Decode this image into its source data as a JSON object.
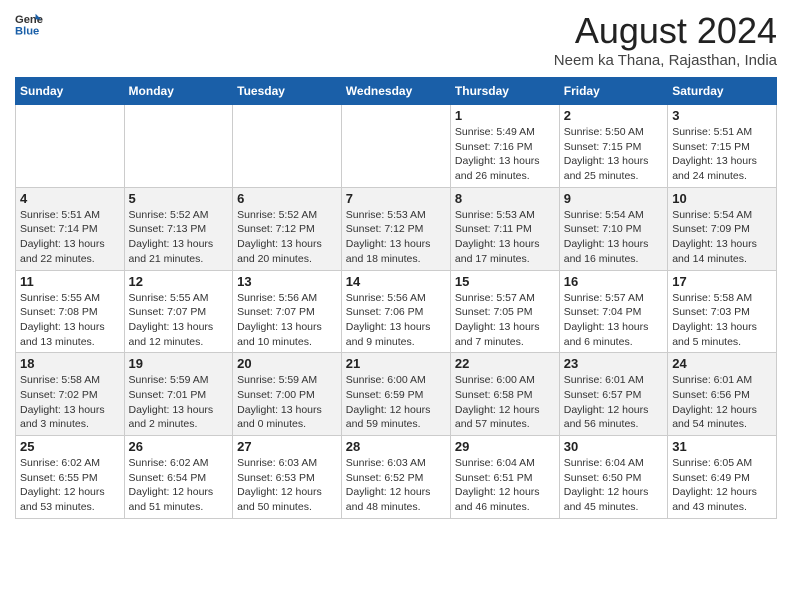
{
  "logo": {
    "line1": "General",
    "line2": "Blue"
  },
  "title": "August 2024",
  "location": "Neem ka Thana, Rajasthan, India",
  "weekdays": [
    "Sunday",
    "Monday",
    "Tuesday",
    "Wednesday",
    "Thursday",
    "Friday",
    "Saturday"
  ],
  "weeks": [
    [
      {
        "day": "",
        "info": ""
      },
      {
        "day": "",
        "info": ""
      },
      {
        "day": "",
        "info": ""
      },
      {
        "day": "",
        "info": ""
      },
      {
        "day": "1",
        "info": "Sunrise: 5:49 AM\nSunset: 7:16 PM\nDaylight: 13 hours\nand 26 minutes."
      },
      {
        "day": "2",
        "info": "Sunrise: 5:50 AM\nSunset: 7:15 PM\nDaylight: 13 hours\nand 25 minutes."
      },
      {
        "day": "3",
        "info": "Sunrise: 5:51 AM\nSunset: 7:15 PM\nDaylight: 13 hours\nand 24 minutes."
      }
    ],
    [
      {
        "day": "4",
        "info": "Sunrise: 5:51 AM\nSunset: 7:14 PM\nDaylight: 13 hours\nand 22 minutes."
      },
      {
        "day": "5",
        "info": "Sunrise: 5:52 AM\nSunset: 7:13 PM\nDaylight: 13 hours\nand 21 minutes."
      },
      {
        "day": "6",
        "info": "Sunrise: 5:52 AM\nSunset: 7:12 PM\nDaylight: 13 hours\nand 20 minutes."
      },
      {
        "day": "7",
        "info": "Sunrise: 5:53 AM\nSunset: 7:12 PM\nDaylight: 13 hours\nand 18 minutes."
      },
      {
        "day": "8",
        "info": "Sunrise: 5:53 AM\nSunset: 7:11 PM\nDaylight: 13 hours\nand 17 minutes."
      },
      {
        "day": "9",
        "info": "Sunrise: 5:54 AM\nSunset: 7:10 PM\nDaylight: 13 hours\nand 16 minutes."
      },
      {
        "day": "10",
        "info": "Sunrise: 5:54 AM\nSunset: 7:09 PM\nDaylight: 13 hours\nand 14 minutes."
      }
    ],
    [
      {
        "day": "11",
        "info": "Sunrise: 5:55 AM\nSunset: 7:08 PM\nDaylight: 13 hours\nand 13 minutes."
      },
      {
        "day": "12",
        "info": "Sunrise: 5:55 AM\nSunset: 7:07 PM\nDaylight: 13 hours\nand 12 minutes."
      },
      {
        "day": "13",
        "info": "Sunrise: 5:56 AM\nSunset: 7:07 PM\nDaylight: 13 hours\nand 10 minutes."
      },
      {
        "day": "14",
        "info": "Sunrise: 5:56 AM\nSunset: 7:06 PM\nDaylight: 13 hours\nand 9 minutes."
      },
      {
        "day": "15",
        "info": "Sunrise: 5:57 AM\nSunset: 7:05 PM\nDaylight: 13 hours\nand 7 minutes."
      },
      {
        "day": "16",
        "info": "Sunrise: 5:57 AM\nSunset: 7:04 PM\nDaylight: 13 hours\nand 6 minutes."
      },
      {
        "day": "17",
        "info": "Sunrise: 5:58 AM\nSunset: 7:03 PM\nDaylight: 13 hours\nand 5 minutes."
      }
    ],
    [
      {
        "day": "18",
        "info": "Sunrise: 5:58 AM\nSunset: 7:02 PM\nDaylight: 13 hours\nand 3 minutes."
      },
      {
        "day": "19",
        "info": "Sunrise: 5:59 AM\nSunset: 7:01 PM\nDaylight: 13 hours\nand 2 minutes."
      },
      {
        "day": "20",
        "info": "Sunrise: 5:59 AM\nSunset: 7:00 PM\nDaylight: 13 hours\nand 0 minutes."
      },
      {
        "day": "21",
        "info": "Sunrise: 6:00 AM\nSunset: 6:59 PM\nDaylight: 12 hours\nand 59 minutes."
      },
      {
        "day": "22",
        "info": "Sunrise: 6:00 AM\nSunset: 6:58 PM\nDaylight: 12 hours\nand 57 minutes."
      },
      {
        "day": "23",
        "info": "Sunrise: 6:01 AM\nSunset: 6:57 PM\nDaylight: 12 hours\nand 56 minutes."
      },
      {
        "day": "24",
        "info": "Sunrise: 6:01 AM\nSunset: 6:56 PM\nDaylight: 12 hours\nand 54 minutes."
      }
    ],
    [
      {
        "day": "25",
        "info": "Sunrise: 6:02 AM\nSunset: 6:55 PM\nDaylight: 12 hours\nand 53 minutes."
      },
      {
        "day": "26",
        "info": "Sunrise: 6:02 AM\nSunset: 6:54 PM\nDaylight: 12 hours\nand 51 minutes."
      },
      {
        "day": "27",
        "info": "Sunrise: 6:03 AM\nSunset: 6:53 PM\nDaylight: 12 hours\nand 50 minutes."
      },
      {
        "day": "28",
        "info": "Sunrise: 6:03 AM\nSunset: 6:52 PM\nDaylight: 12 hours\nand 48 minutes."
      },
      {
        "day": "29",
        "info": "Sunrise: 6:04 AM\nSunset: 6:51 PM\nDaylight: 12 hours\nand 46 minutes."
      },
      {
        "day": "30",
        "info": "Sunrise: 6:04 AM\nSunset: 6:50 PM\nDaylight: 12 hours\nand 45 minutes."
      },
      {
        "day": "31",
        "info": "Sunrise: 6:05 AM\nSunset: 6:49 PM\nDaylight: 12 hours\nand 43 minutes."
      }
    ]
  ]
}
